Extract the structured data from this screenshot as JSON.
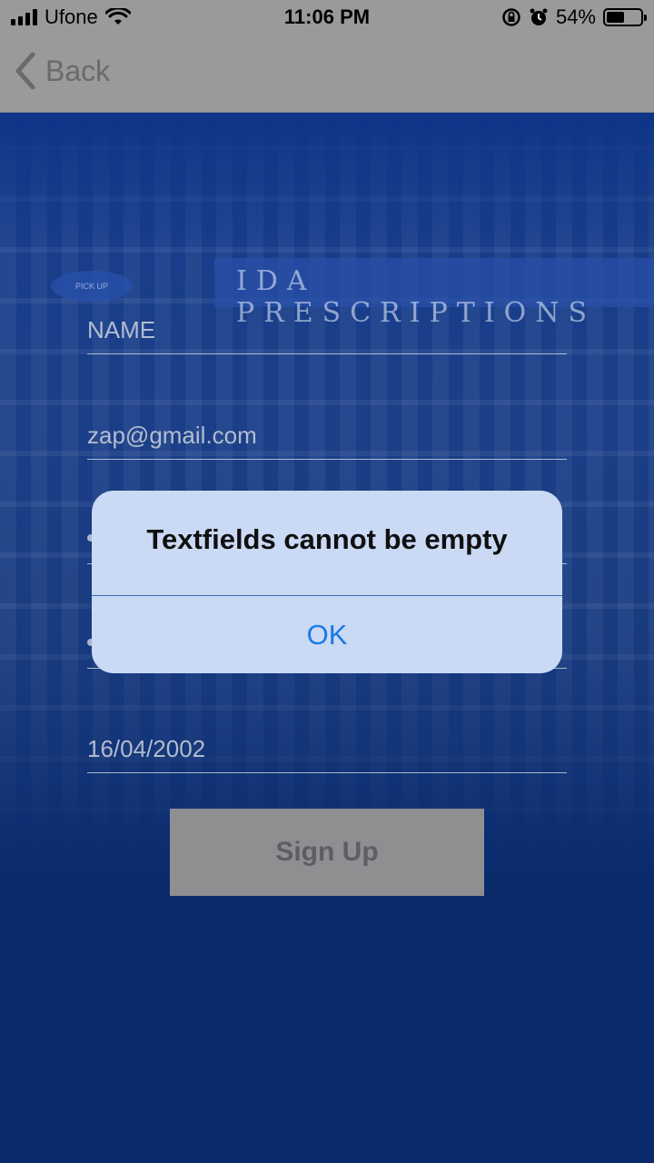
{
  "status_bar": {
    "carrier": "Ufone",
    "time": "11:06 PM",
    "battery": "54%",
    "battery_level": 0.54
  },
  "nav": {
    "back_label": "Back"
  },
  "background": {
    "banner_text": "IDA PRESCRIPTIONS",
    "pickup_text": "PICK UP"
  },
  "form": {
    "name_placeholder": "NAME",
    "email_value": "zap@gmail.com",
    "date_value": "16/04/2002",
    "signup_label": "Sign Up"
  },
  "alert": {
    "title": "Textfields cannot be empty",
    "ok_label": "OK"
  },
  "colors": {
    "accent": "#1a7ae6",
    "background": "#0a2a6b",
    "alert_bg": "#cad9f4"
  }
}
